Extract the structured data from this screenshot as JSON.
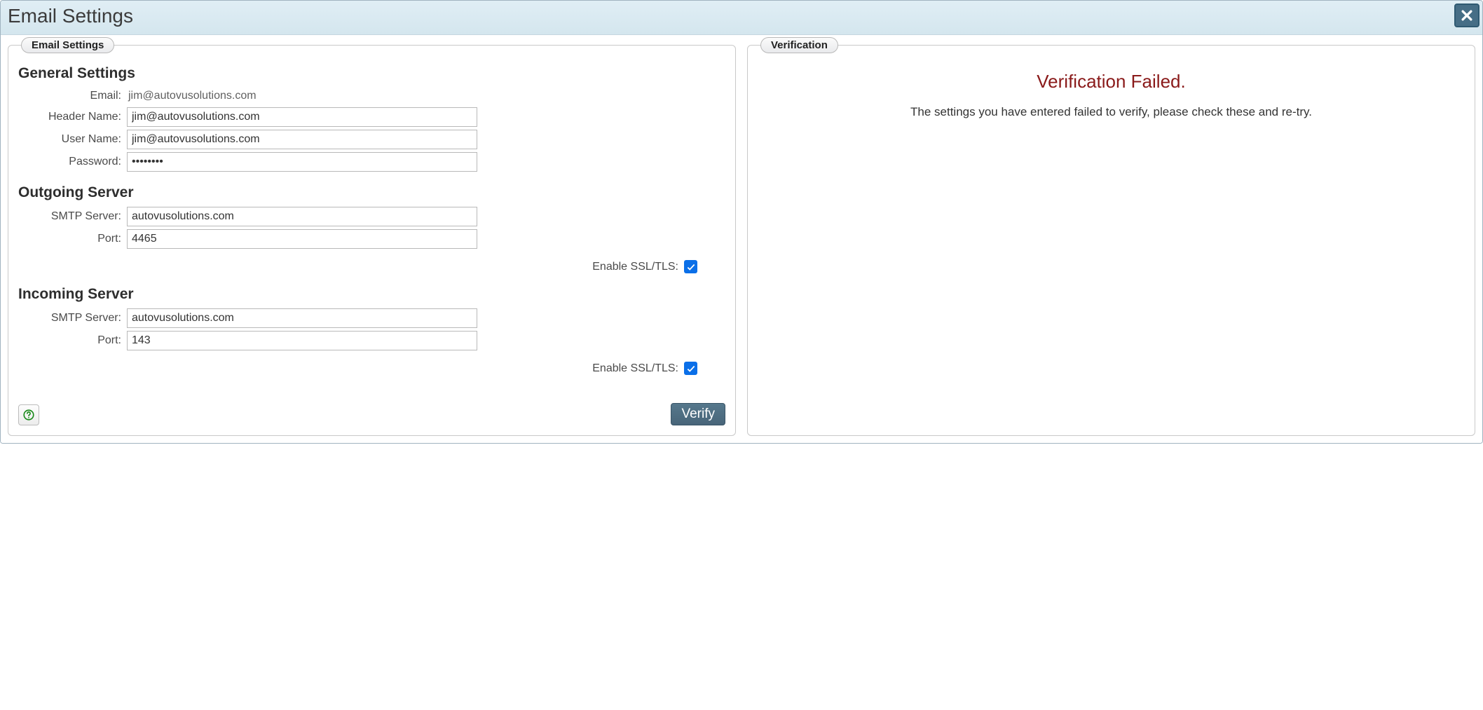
{
  "dialog": {
    "title": "Email Settings"
  },
  "icons": {
    "close": "close-icon",
    "help": "help-icon"
  },
  "left": {
    "legend": "Email Settings",
    "general": {
      "heading": "General Settings",
      "email_label": "Email:",
      "email_value": "jim@autovusolutions.com",
      "header_name_label": "Header Name:",
      "header_name_value": "jim@autovusolutions.com",
      "user_name_label": "User Name:",
      "user_name_value": "jim@autovusolutions.com",
      "password_label": "Password:",
      "password_value": "********"
    },
    "outgoing": {
      "heading": "Outgoing Server",
      "server_label": "SMTP Server:",
      "server_value": "autovusolutions.com",
      "port_label": "Port:",
      "port_value": "4465",
      "ssl_label": "Enable SSL/TLS:",
      "ssl_checked": true
    },
    "incoming": {
      "heading": "Incoming Server",
      "server_label": "SMTP Server:",
      "server_value": "autovusolutions.com",
      "port_label": "Port:",
      "port_value": "143",
      "ssl_label": "Enable SSL/TLS:",
      "ssl_checked": true
    },
    "verify_button": "Verify"
  },
  "right": {
    "legend": "Verification",
    "title": "Verification Failed.",
    "message": "The settings you have entered failed to verify, please check these and re-try."
  }
}
